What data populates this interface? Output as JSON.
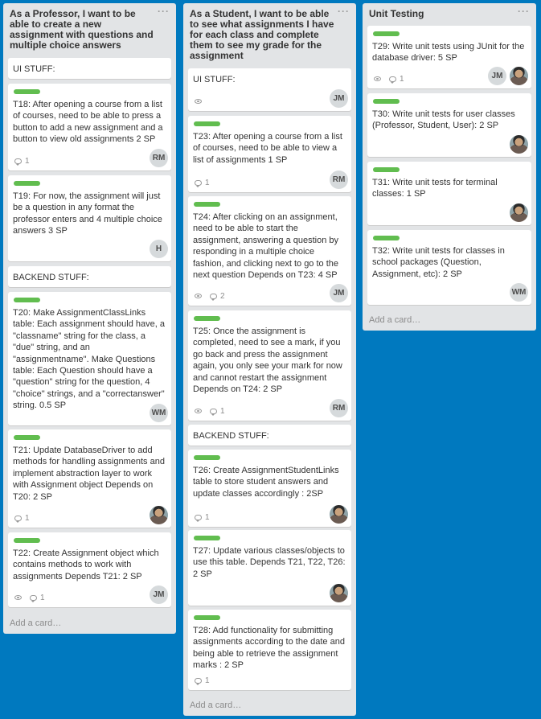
{
  "lists": [
    {
      "title": "As a Professor, I want to be able to create a new assignment with questions and multiple choice answers",
      "menu": "···",
      "add_card": "Add a card…",
      "cards": [
        {
          "title": "UI STUFF:"
        },
        {
          "title": "T18: After opening a course from a list of courses, need to be able to press a button to add a new assignment and a button to view old assignments 2 SP",
          "comments": "1",
          "avatar": "RM"
        },
        {
          "title": "T19: For now, the assignment will just be a question in any format the professor enters and 4 multiple choice answers 3 SP",
          "avatar": "H"
        },
        {
          "title": "BACKEND STUFF:"
        },
        {
          "title": "T20: Make AssignmentClassLinks table: Each assignment should have, a \"classname\" string for the class, a \"due\" string, and an \"assignmentname\". Make Questions table: Each Question should have a \"question\" string for the question, 4 \"choice\" strings, and a \"correctanswer\" string. 0.5 SP",
          "avatar": "WM"
        },
        {
          "title": "T21: Update DatabaseDriver to add methods for handling assignments and implement abstraction layer to work with Assignment object Depends on T20: 2 SP",
          "comments": "1"
        },
        {
          "title": "T22: Create Assignment object which contains methods to work with assignments Depends T21: 2 SP",
          "comments": "1",
          "avatar": "JM"
        }
      ]
    },
    {
      "title": "As a Student, I want to be able to see what assignments I have for each class and complete them to see my grade for the assignment",
      "menu": "···",
      "add_card": "Add a card…",
      "cards": [
        {
          "title": "UI STUFF:",
          "avatar": "JM"
        },
        {
          "title": "T23: After opening a course from a list of courses, need to be able to view a list of assignments 1 SP",
          "comments": "1",
          "avatar": "RM"
        },
        {
          "title": "T24: After clicking on an assignment, need to be able to start the assignment, answering a question by responding in a multiple choice fashion, and clicking next to go to the next question Depends on T23: 4 SP",
          "comments": "2",
          "avatar": "JM"
        },
        {
          "title": "T25: Once the assignment is completed, need to see a mark, if you go back and press the assignment again, you only see your mark for now and cannot restart the assignment Depends on T24: 2 SP",
          "comments": "1",
          "avatar": "RM"
        },
        {
          "title": "BACKEND STUFF:"
        },
        {
          "title": "T26: Create AssignmentStudentLinks table to store student answers and update classes accordingly : 2SP",
          "comments": "1"
        },
        {
          "title": "T27: Update various classes/objects to use this table. Depends T21, T22, T26: 2 SP"
        },
        {
          "title": "T28: Add functionality for submitting assignments according to the date and being able to retrieve the assignment marks : 2 SP",
          "comments": "1"
        }
      ]
    },
    {
      "title": "Unit Testing",
      "menu": "···",
      "add_card": "Add a card…",
      "cards": [
        {
          "title": "T29: Write unit tests using JUnit for the database driver: 5 SP",
          "comments": "1",
          "avatar": "JM"
        },
        {
          "title": "T30: Write unit tests for user classes (Professor, Student, User): 2 SP"
        },
        {
          "title": "T31: Write unit tests for terminal classes: 1 SP"
        },
        {
          "title": "T32: Write unit tests for classes in school packages (Question, Assignment, etc): 2 SP",
          "avatar": "WM"
        }
      ]
    }
  ]
}
